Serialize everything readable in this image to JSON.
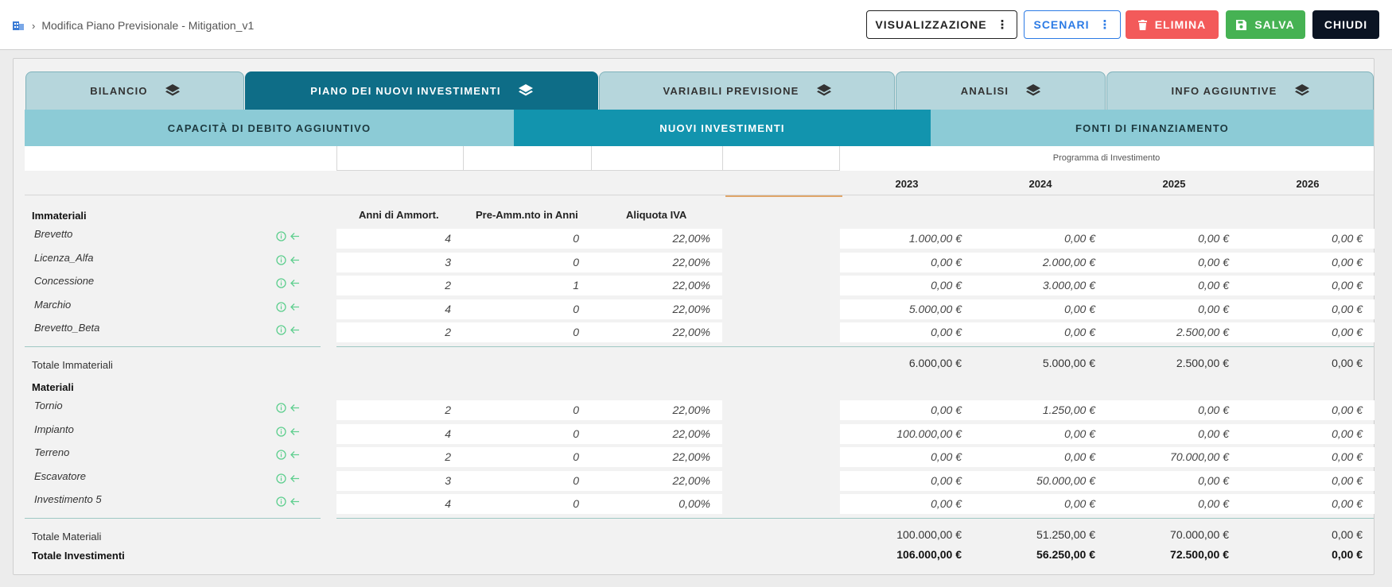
{
  "breadcrumb": {
    "page": "Modifica Piano Previsionale - Mitigation_v1"
  },
  "toolbar": {
    "visualizzazione": "VISUALIZZAZIONE",
    "scenari": "SCENARI",
    "elimina": "ELIMINA",
    "salva": "SALVA",
    "chiudi": "CHIUDI"
  },
  "tabs": [
    "BILANCIO",
    "PIANO DEI NUOVI INVESTIMENTI",
    "VARIABILI PREVISIONE",
    "ANALISI",
    "INFO AGGIUNTIVE"
  ],
  "active_tab": 1,
  "subtabs": [
    "CAPACITÀ DI DEBITO AGGIUNTIVO",
    "NUOVI INVESTIMENTI",
    "FONTI DI FINANZIAMENTO"
  ],
  "active_subtab": 1,
  "table": {
    "program_header": "Programma di Investimento",
    "years": [
      "2023",
      "2024",
      "2025",
      "2026"
    ],
    "columns": {
      "ammort": "Anni di Ammort.",
      "pre_amm": "Pre-Amm.nto in Anni",
      "iva": "Aliquota IVA"
    },
    "sections": [
      {
        "title": "Immateriali",
        "rows": [
          {
            "name": "Brevetto",
            "ammort": "4",
            "pre": "0",
            "iva": "22,00%",
            "values": [
              "1.000,00 €",
              "0,00 €",
              "0,00 €",
              "0,00 €"
            ]
          },
          {
            "name": "Licenza_Alfa",
            "ammort": "3",
            "pre": "0",
            "iva": "22,00%",
            "values": [
              "0,00 €",
              "2.000,00 €",
              "0,00 €",
              "0,00 €"
            ]
          },
          {
            "name": "Concessione",
            "ammort": "2",
            "pre": "1",
            "iva": "22,00%",
            "values": [
              "0,00 €",
              "3.000,00 €",
              "0,00 €",
              "0,00 €"
            ]
          },
          {
            "name": "Marchio",
            "ammort": "4",
            "pre": "0",
            "iva": "22,00%",
            "values": [
              "5.000,00 €",
              "0,00 €",
              "0,00 €",
              "0,00 €"
            ]
          },
          {
            "name": "Brevetto_Beta",
            "ammort": "2",
            "pre": "0",
            "iva": "22,00%",
            "values": [
              "0,00 €",
              "0,00 €",
              "2.500,00 €",
              "0,00 €"
            ]
          }
        ],
        "total_label": "Totale Immateriali",
        "totals": [
          "6.000,00 €",
          "5.000,00 €",
          "2.500,00 €",
          "0,00 €"
        ]
      },
      {
        "title": "Materiali",
        "rows": [
          {
            "name": "Tornio",
            "ammort": "2",
            "pre": "0",
            "iva": "22,00%",
            "values": [
              "0,00 €",
              "1.250,00 €",
              "0,00 €",
              "0,00 €"
            ]
          },
          {
            "name": "Impianto",
            "ammort": "4",
            "pre": "0",
            "iva": "22,00%",
            "values": [
              "100.000,00 €",
              "0,00 €",
              "0,00 €",
              "0,00 €"
            ]
          },
          {
            "name": "Terreno",
            "ammort": "2",
            "pre": "0",
            "iva": "22,00%",
            "values": [
              "0,00 €",
              "0,00 €",
              "70.000,00 €",
              "0,00 €"
            ]
          },
          {
            "name": "Escavatore",
            "ammort": "3",
            "pre": "0",
            "iva": "22,00%",
            "values": [
              "0,00 €",
              "50.000,00 €",
              "0,00 €",
              "0,00 €"
            ]
          },
          {
            "name": "Investimento 5",
            "ammort": "4",
            "pre": "0",
            "iva": "0,00%",
            "values": [
              "0,00 €",
              "0,00 €",
              "0,00 €",
              "0,00 €"
            ]
          }
        ],
        "total_label": "Totale Materiali",
        "totals": [
          "100.000,00 €",
          "51.250,00 €",
          "70.000,00 €",
          "0,00 €"
        ]
      }
    ],
    "grand_total_label": "Totale Investimenti",
    "grand_totals": [
      "106.000,00 €",
      "56.250,00 €",
      "72.500,00 €",
      "0,00 €"
    ]
  },
  "colors": {
    "tab_active": "#0e6d87",
    "tab_inactive": "#b6d6dc",
    "subtab_active": "#1294ae",
    "subtab_inactive": "#8ccbd6",
    "elimina": "#f35a5a",
    "salva": "#46b253",
    "chiudi": "#0b1423",
    "scenari": "#2c7be5",
    "row_icon": "#5fcf8f"
  },
  "icons": {
    "breadcrumb": "building-icon",
    "tab": "layers-icon",
    "menu": "more-vertical-icon",
    "elimina": "trash-icon",
    "salva": "save-icon",
    "row_info": "info-circle-icon",
    "row_back": "arrow-left-icon"
  }
}
